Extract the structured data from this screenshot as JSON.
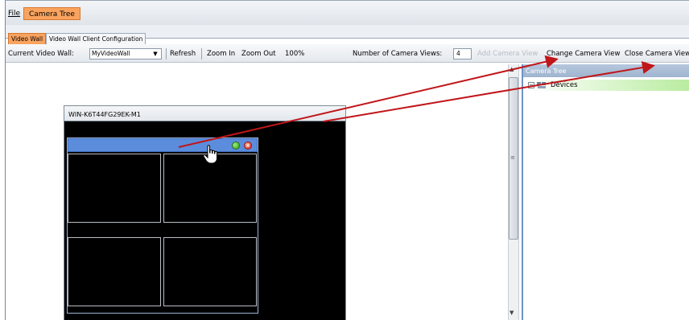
{
  "menubar": {
    "file": "File",
    "camera_tree": "Camera Tree"
  },
  "tabs": [
    {
      "label": "Video Wall",
      "active": true
    },
    {
      "label": "Video Wall Client Configuration",
      "active": false
    }
  ],
  "toolbar": {
    "current_label": "Current Video Wall:",
    "current_value": "MyVideoWall",
    "refresh": "Refresh",
    "zoom_in": "Zoom In",
    "zoom_out": "Zoom Out",
    "zoom_level": "100%",
    "num_views_label": "Number of Camera Views:",
    "num_views_value": "4",
    "add_view": "Add Camera View",
    "change_view": "Change Camera View",
    "close_view": "Close Camera View"
  },
  "video_wall": {
    "window_title": "WIN-K6T44FG29EK-M1"
  },
  "camera_tree": {
    "title": "Camera Tree",
    "root": "Devices"
  },
  "colors": {
    "accent_orange": "#f9a35f",
    "view_bar_blue": "#5b8ddc",
    "arrow_red": "#c0161a",
    "add_ok_green": "#2f9f1c",
    "close_red": "#d62b1c"
  },
  "icons": [
    "chevron-down-icon",
    "add-icon",
    "close-icon",
    "hand-cursor-icon",
    "tree-expander-icon",
    "device-group-icon",
    "scroll-up-icon",
    "scroll-down-icon"
  ]
}
